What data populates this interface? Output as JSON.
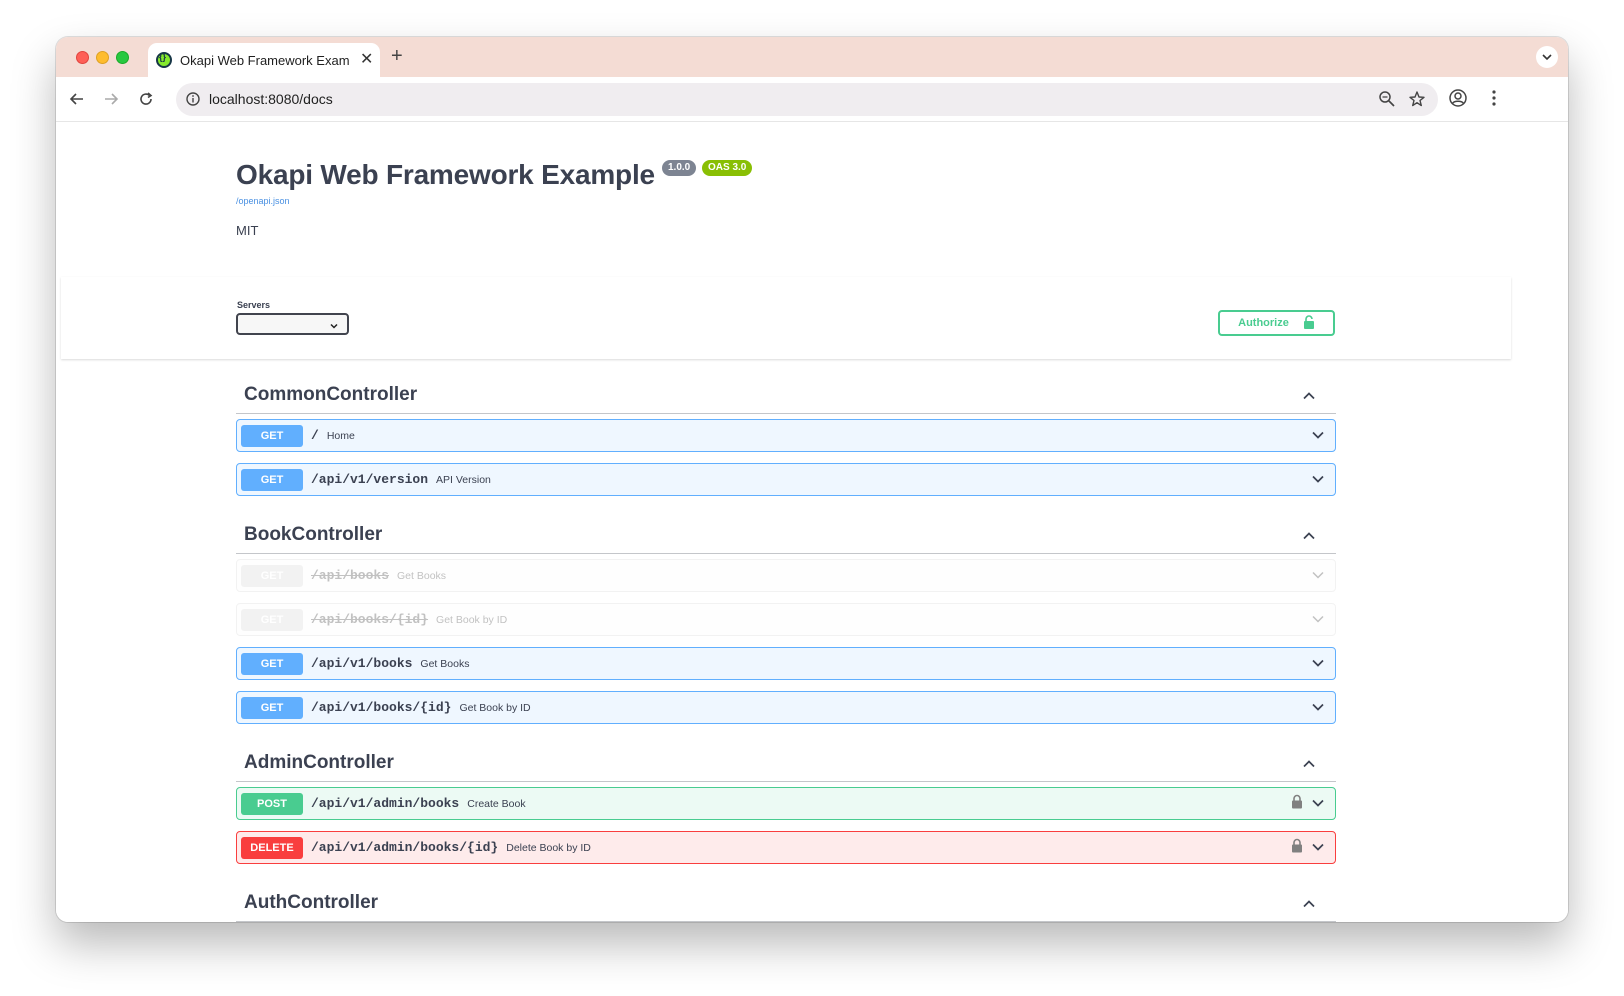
{
  "browser": {
    "tab_title": "Okapi Web Framework Example",
    "new_tab": "+",
    "close": "✕",
    "url": "localhost:8080/docs"
  },
  "info": {
    "title": "Okapi Web Framework Example",
    "version": "1.0.0",
    "oas": "OAS 3.0",
    "spec_link": "/openapi.json",
    "license": "MIT"
  },
  "scheme": {
    "servers_label": "Servers",
    "authorize_label": "Authorize"
  },
  "tags": [
    {
      "name": "CommonController",
      "operations": [
        {
          "method": "GET",
          "path": "/",
          "summary": "Home"
        },
        {
          "method": "GET",
          "path": "/api/v1/version",
          "summary": "API Version"
        }
      ]
    },
    {
      "name": "BookController",
      "operations": [
        {
          "method": "GET",
          "path": "/api/books",
          "summary": "Get Books",
          "deprecated": true
        },
        {
          "method": "GET",
          "path": "/api/books/{id}",
          "summary": "Get Book by ID",
          "deprecated": true
        },
        {
          "method": "GET",
          "path": "/api/v1/books",
          "summary": "Get Books"
        },
        {
          "method": "GET",
          "path": "/api/v1/books/{id}",
          "summary": "Get Book by ID"
        }
      ]
    },
    {
      "name": "AdminController",
      "operations": [
        {
          "method": "POST",
          "path": "/api/v1/admin/books",
          "summary": "Create Book",
          "locked": true
        },
        {
          "method": "DELETE",
          "path": "/api/v1/admin/books/{id}",
          "summary": "Delete Book by ID",
          "locked": true
        }
      ]
    },
    {
      "name": "AuthController",
      "operations": []
    }
  ],
  "colors": {
    "get": "#61affe",
    "post": "#49cc90",
    "delete": "#f93e3e",
    "deprecated": "#ebebeb",
    "text": "#3b4151"
  },
  "icons": {
    "back": "arrow-left-icon",
    "forward": "arrow-right-icon",
    "reload": "reload-icon",
    "site_info": "info-icon",
    "zoom": "zoom-icon",
    "bookmark": "star-icon",
    "profile": "profile-icon",
    "menu": "kebab-menu-icon",
    "lock": "lock-icon",
    "chevron_down": "chevron-down-icon",
    "chevron_up": "chevron-up-icon"
  }
}
